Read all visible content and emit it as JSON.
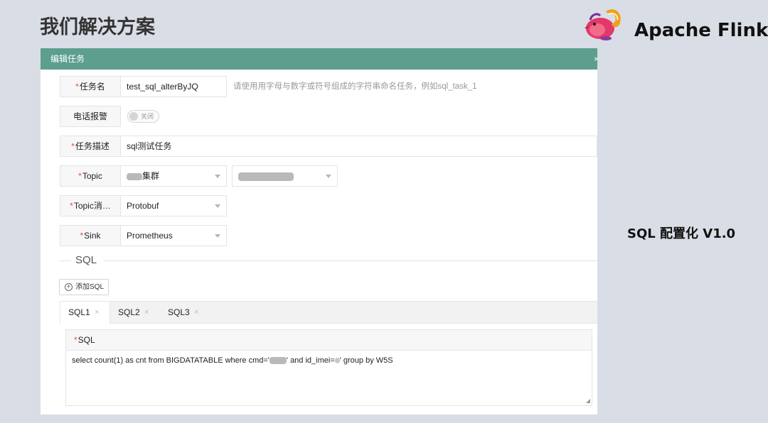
{
  "slide": {
    "title": "我们解决方案",
    "brand_name": "Apache Flink",
    "side_note": "SQL 配置化  V1.0"
  },
  "dialog": {
    "title": "编辑任务",
    "close_label": "×",
    "task_name": {
      "required": "*",
      "label": "任务名",
      "value": "test_sql_alterByJQ",
      "hint": "请使用用字母与数字或符号组成的字符串命名任务，例如sql_task_1"
    },
    "phone_alarm": {
      "label": "电话报警",
      "toggle_text": "关闭",
      "enabled": false
    },
    "task_desc": {
      "required": "*",
      "label": "任务描述",
      "value": "sql测试任务"
    },
    "topic": {
      "required": "*",
      "label": "Topic",
      "cluster_value": "集群",
      "second_value": ""
    },
    "topic_msg": {
      "required": "*",
      "label": "Topic消…",
      "value": "Protobuf"
    },
    "sink": {
      "required": "*",
      "label": "Sink",
      "value": "Prometheus"
    },
    "sql_section": {
      "title": "SQL",
      "add_button": "添加SQL",
      "add_icon": "plus-circle-icon",
      "tabs": [
        {
          "label": "SQL1",
          "close": "×",
          "active": true
        },
        {
          "label": "SQL2",
          "close": "×",
          "active": false
        },
        {
          "label": "SQL3",
          "close": "×",
          "active": false
        }
      ],
      "editor_required": "*",
      "editor_label": "SQL",
      "query_part1": "select count(1) as cnt from BIGDATATABLE where cmd='",
      "query_part2": "' and id_imei=",
      "query_part3": "'  group by W5S"
    }
  },
  "colors": {
    "header_green": "#5c9f8e",
    "required_red": "#e0542e",
    "background": "#d9dde5"
  }
}
